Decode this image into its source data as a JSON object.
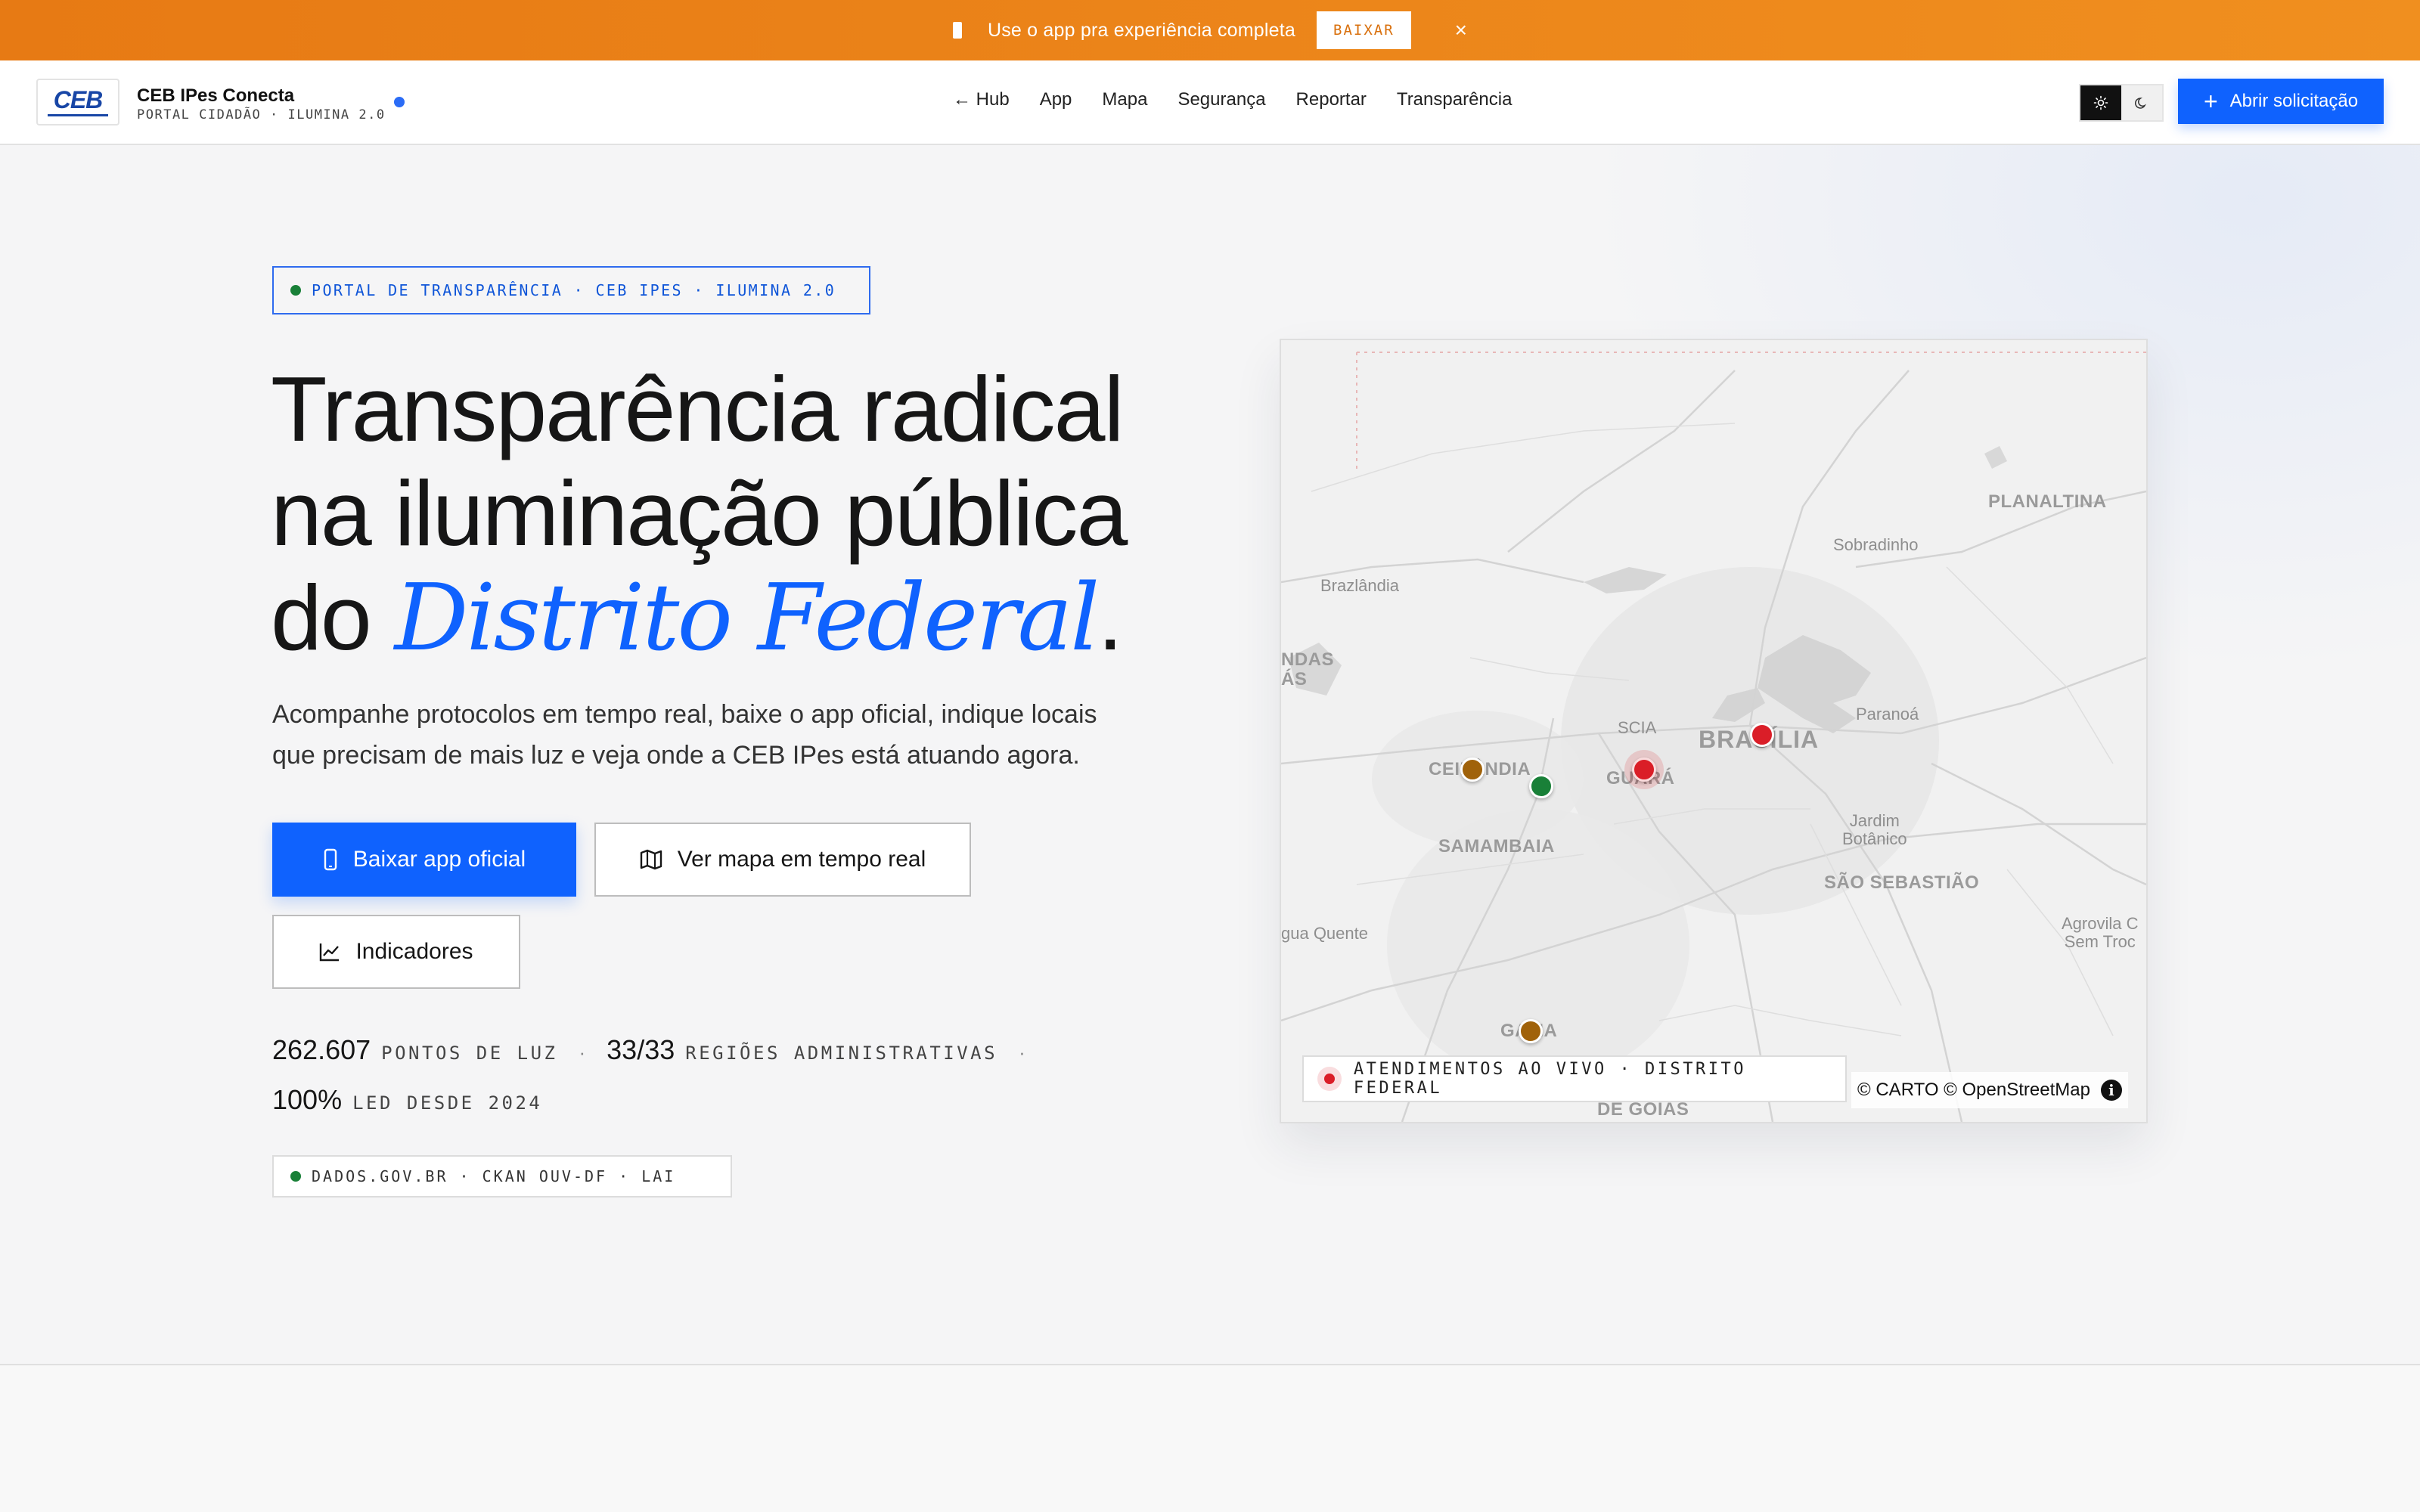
{
  "banner": {
    "text": "Use o app pra experiência completa",
    "button": "BAIXAR",
    "close": "×"
  },
  "header": {
    "brand_name": "CEB IPes Conecta",
    "brand_sub": "PORTAL CIDADÃO · ILUMINA 2.0",
    "logo_text": "CEB",
    "nav": [
      "← Hub",
      "App",
      "Mapa",
      "Segurança",
      "Reportar",
      "Transparência"
    ],
    "cta": "Abrir solicitação",
    "cta_icon": "+"
  },
  "hero": {
    "tag": "PORTAL DE TRANSPARÊNCIA · CEB IPES · ILUMINA 2.0",
    "headline_line1": "Transparência radical",
    "headline_line2": "na iluminação pública",
    "headline_prefix": "do ",
    "headline_accent": "Distrito Federal",
    "headline_suffix": ".",
    "lead": "Acompanhe protocolos em tempo real, baixe o app oficial, indique locais que precisam de mais luz e veja onde a CEB IPes está atuando agora.",
    "buttons": {
      "download": "Baixar app oficial",
      "map": "Ver mapa em tempo real",
      "indicators": "Indicadores"
    },
    "stats": {
      "points_value": "262.607",
      "points_label": "PONTOS DE LUZ",
      "regions_value": "33/33",
      "regions_label": "REGIÕES ADMINISTRATIVAS",
      "led_value": "100%",
      "led_label": "LED DESDE 2024",
      "separator": "·"
    },
    "data_tag": "DADOS.GOV.BR · CKAN OUV-DF · LAI"
  },
  "map": {
    "labels": {
      "planaltina": "PLANALTINA",
      "sobradinho": "Sobradinho",
      "brazlandia": "Brazlândia",
      "aguas_lindas": "NDAS\nÁS",
      "scia": "SCIA",
      "brasilia": "BRASÍLIA",
      "paranoa": "Paranoá",
      "ceilandia": "CEILÂNDIA",
      "guara": "GUARÁ",
      "samambaia": "SAMAMBAIA",
      "jardim_botanico": "Jardim\nBotânico",
      "sao_sebastiao": "SÃO SEBASTIÃO",
      "agua_quente": "gua Quente",
      "agrovila": "Agrovila C\nSem Troc",
      "gama": "GAMA",
      "de_goias": "DE GOIÁS"
    },
    "markers": [
      {
        "status": "em-andamento",
        "color": "#a0620a"
      },
      {
        "status": "concluido",
        "color": "#198038"
      },
      {
        "status": "urgente",
        "color": "#da1e28"
      },
      {
        "status": "urgente",
        "color": "#da1e28"
      },
      {
        "status": "em-andamento",
        "color": "#a0620a"
      }
    ],
    "live_badge": "ATENDIMENTOS AO VIVO · DISTRITO FEDERAL",
    "attribution": "© CARTO © OpenStreetMap",
    "info": "i"
  },
  "colors": {
    "accent": "#0f62fe",
    "banner": "#ef8a1c",
    "success": "#198038",
    "danger": "#da1e28"
  },
  "icons": {
    "phone": "phone-icon",
    "map": "map-icon",
    "chart": "line-chart-icon",
    "sun": "sun-icon",
    "moon": "moon-icon",
    "plus": "plus-icon",
    "close": "close-icon",
    "info": "info-icon"
  }
}
